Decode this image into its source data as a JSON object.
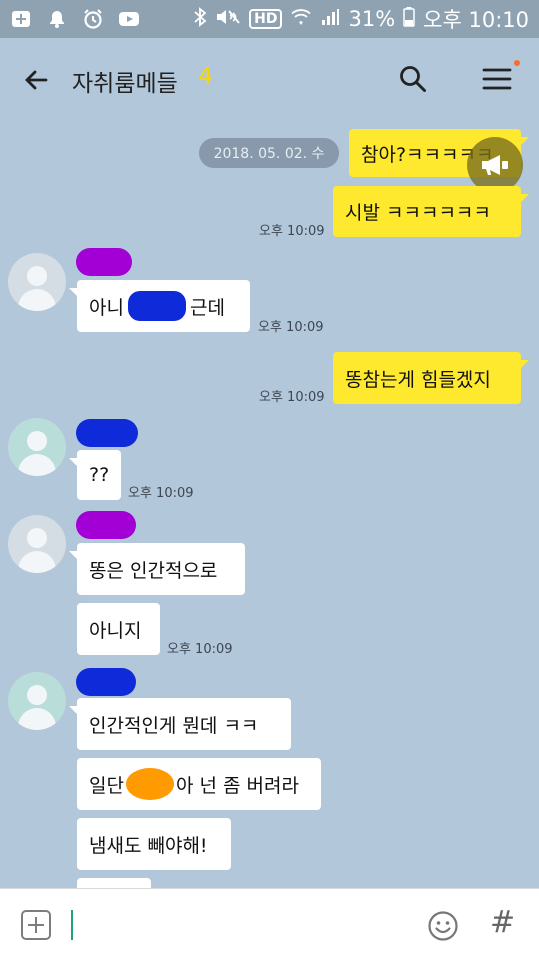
{
  "status_bar": {
    "hd": "HD",
    "battery": "31%",
    "time": "오후 10:10"
  },
  "header": {
    "title": "자취룸메들",
    "member_count": "4"
  },
  "chat": {
    "date_divider": "2018. 05. 02. 수",
    "messages": [
      {
        "from": "me",
        "text": "참아?ㅋㅋㅋㅋㅋ",
        "time": ""
      },
      {
        "from": "me",
        "text": "시발 ㅋㅋㅋㅋㅋㅋ",
        "time": "오후 10:09"
      },
      {
        "from": "other",
        "text_before": "아니",
        "text_after": "근데",
        "time": "오후 10:09"
      },
      {
        "from": "me",
        "text": "똥참는게 힘들겠지",
        "time": "오후 10:09"
      },
      {
        "from": "other",
        "text": "??",
        "time": "오후 10:09"
      },
      {
        "from": "other",
        "text": "똥은 인간적으로",
        "time": ""
      },
      {
        "from": "other",
        "text": "아니지",
        "time": "오후 10:09"
      },
      {
        "from": "other",
        "text": "인간적인게 뭔데 ㅋㅋ",
        "time": ""
      },
      {
        "from": "other",
        "text_before": "일단",
        "text_after": "아 넌 좀 버려라",
        "time": ""
      },
      {
        "from": "other",
        "text": "냄새도 빼야해!",
        "time": ""
      }
    ]
  },
  "colors": {
    "background": "#b2c7da",
    "my_bubble": "#ffe92e",
    "other_bubble": "#ffffff",
    "accent": "#f5d900"
  },
  "icons": {
    "back": "arrow-left-icon",
    "search": "search-icon",
    "menu": "hamburger-menu-icon",
    "attach": "plus-box-icon",
    "emoji": "smiley-icon",
    "hash": "hashtag-icon",
    "speaker": "megaphone-icon"
  },
  "input": {
    "hashtag_label": "#"
  }
}
